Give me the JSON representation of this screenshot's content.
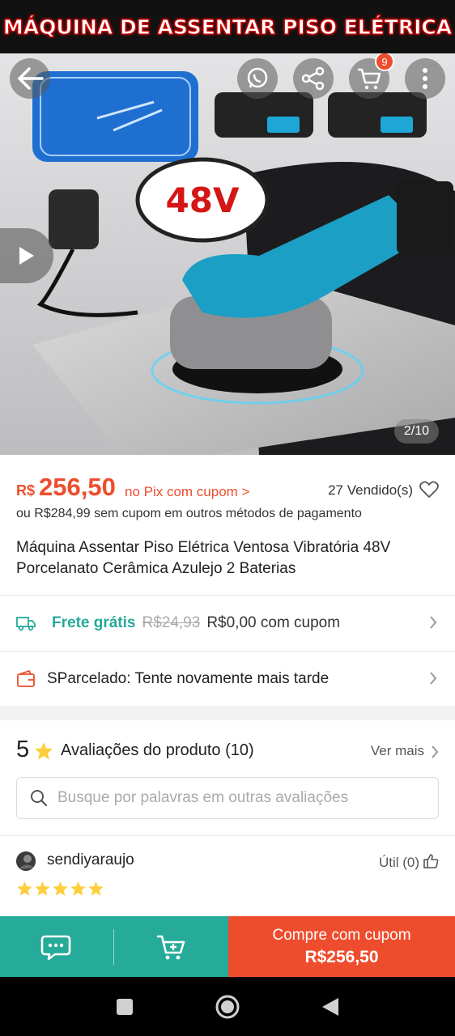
{
  "banner": {
    "text": "MÁQUINA DE ASSENTAR PISO ELÉTRICA"
  },
  "hero": {
    "image_text": "48V",
    "battery_label": "48V",
    "counter": "2/10",
    "cart_count": "9",
    "icons": [
      "back-arrow-icon",
      "whatsapp-icon",
      "share-icon",
      "cart-icon",
      "more-vertical-icon",
      "play-icon"
    ]
  },
  "price": {
    "currency": "R$",
    "value": "256,50",
    "pix_label": "no Pix com cupom >",
    "sold": "27 Vendido(s)",
    "alt_price": "ou R$284,99 sem cupom em outros métodos de pagamento"
  },
  "product": {
    "title": "Máquina Assentar Piso Elétrica Ventosa Vibratória 48V Porcelanato Cerâmica Azulejo 2 Baterias"
  },
  "shipping": {
    "label": "Frete grátis",
    "old_price": "R$24,93",
    "new_price": "R$0,00 com cupom"
  },
  "installments": {
    "text": "SParcelado: Tente novamente mais tarde"
  },
  "reviews": {
    "score": "5",
    "label": "Avaliações do produto",
    "count": "(10)",
    "see_more": "Ver mais",
    "search_placeholder": "Busque por palavras em outras avaliações",
    "first": {
      "username": "sendiyaraujo",
      "helpful": "Útil (0)",
      "stars": 5
    }
  },
  "bottom_bar": {
    "buy_line1": "Compre com cupom",
    "buy_line2": "R$256,50"
  },
  "colors": {
    "accent": "#ee4d2d",
    "teal": "#26aa99",
    "star": "#ffce3d"
  }
}
